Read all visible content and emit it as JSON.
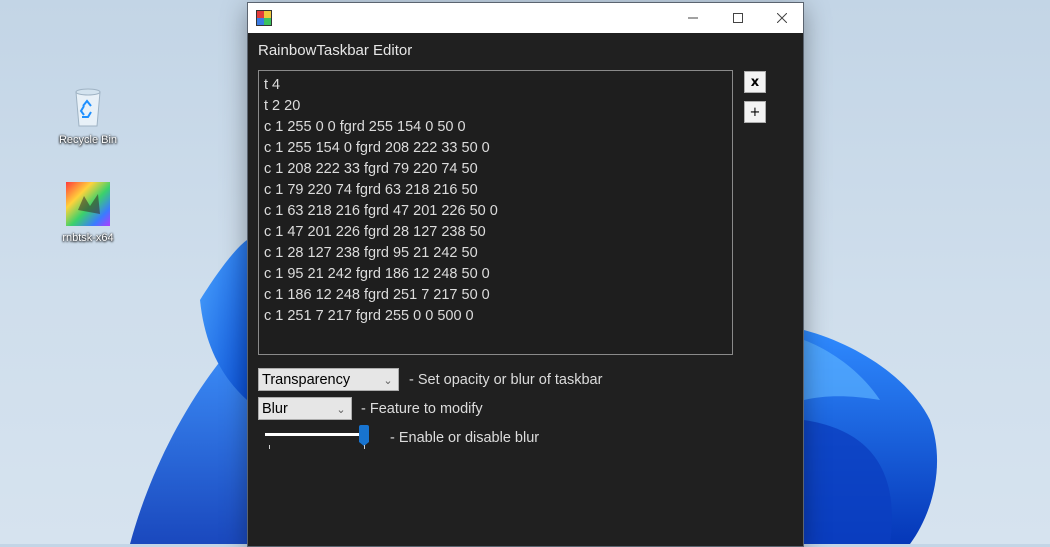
{
  "window": {
    "title": "RainbowTaskbar Editor",
    "caption": {
      "minimize": "—",
      "maximize": "☐",
      "close": "✕"
    }
  },
  "editor": {
    "lines": "t 4\nt 2 20\nc 1 255 0 0 fgrd 255 154 0 50 0\nc 1 255 154 0 fgrd 208 222 33 50 0\nc 1 208 222 33 fgrd 79 220 74 50\nc 1 79 220 74 fgrd 63 218 216 50\nc 1 63 218 216 fgrd 47 201 226 50 0\nc 1 47 201 226 fgrd 28 127 238 50\nc 1 28 127 238 fgrd 95 21 242 50\nc 1 95 21 242 fgrd 186 12 248 50 0\nc 1 186 12 248 fgrd 251 7 217 50 0\nc 1 251 7 217 fgrd 255 0 0 500 0"
  },
  "buttons": {
    "remove": "x",
    "add": "+"
  },
  "controls": {
    "setting_combo": "Transparency",
    "setting_desc": "- Set opacity or blur of taskbar",
    "feature_combo": "Blur",
    "feature_desc": "- Feature to modify",
    "toggle_desc": "- Enable or disable blur",
    "slider_value": 1
  },
  "desktop": {
    "icons": [
      {
        "label": "Recycle Bin",
        "icon": "recycle-bin-icon"
      },
      {
        "label": "rnbtsk-x64",
        "icon": "rainbow-cat-icon"
      }
    ]
  },
  "colors": {
    "window_bg": "#202020",
    "accent": "#1874d0"
  }
}
